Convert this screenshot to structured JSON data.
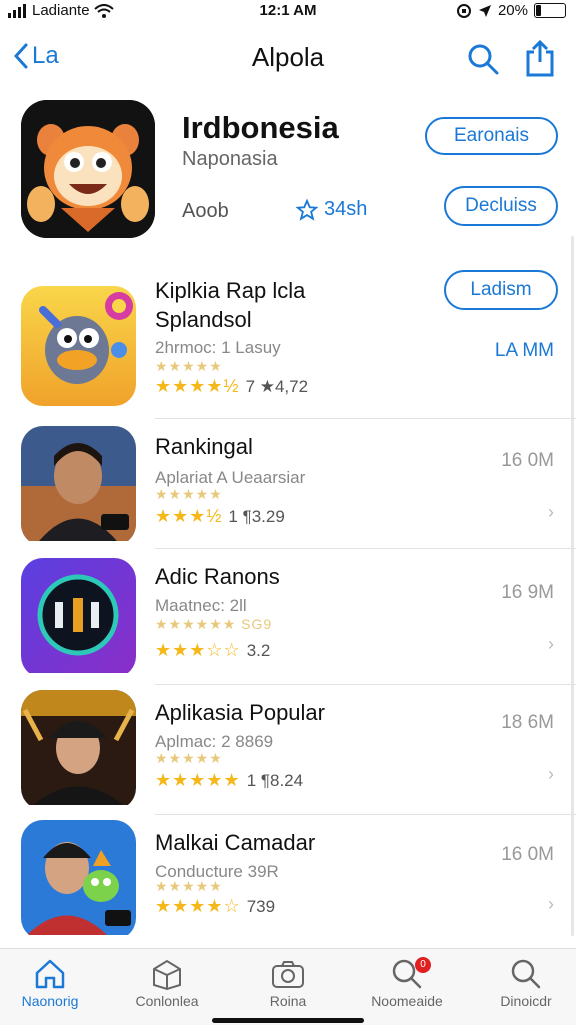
{
  "status": {
    "carrier": "Ladiante",
    "time": "12:1 AM",
    "battery": "20%",
    "battery_level": 0.2
  },
  "nav": {
    "back_label": "La",
    "title": "Alpola"
  },
  "featured": {
    "title": "Irdbonesia",
    "subtitle": "Naponasia",
    "developer": "Aoob",
    "rating": "34sh",
    "button_primary": "Earonais",
    "button_secondary": "Decluiss"
  },
  "apps": [
    {
      "name_line1": "Kiplkia Rap lcla",
      "name_line2": "Splandsol",
      "subtitle": "2hrmoc: 1 Lasuy",
      "faint_stars": "★★★★★",
      "stars": "★★★★½",
      "rating": "7 ★4,72",
      "action": "Ladism",
      "size": "LA MM",
      "chevron": ""
    },
    {
      "name_line1": "Rankingal",
      "name_line2": "",
      "subtitle": "Aplariat A Ueaarsiar",
      "faint_stars": "★★★★★",
      "stars": "★★★½",
      "rating": "1 ¶3.29",
      "action": "",
      "size": "16 0M",
      "chevron": "›"
    },
    {
      "name_line1": "Adic Ranons",
      "name_line2": "",
      "subtitle": "Maatnec: 2ll",
      "faint_stars": "★★★★★★ SG9",
      "stars": "★★★☆☆",
      "rating": "3.2",
      "action": "",
      "size": "16 9M",
      "chevron": "›"
    },
    {
      "name_line1": "Aplikasia Popular",
      "name_line2": "",
      "subtitle": "Aplmac: 2 8869",
      "faint_stars": "★★★★★",
      "stars": "★★★★★",
      "rating": "1 ¶8.24",
      "action": "",
      "size": "18 6M",
      "chevron": "›"
    },
    {
      "name_line1": "Malkai Camadar",
      "name_line2": "",
      "subtitle": "Conducture 39R",
      "faint_stars": "★★★★★",
      "stars": "★★★★☆",
      "rating": "739",
      "action": "",
      "size": "16 0M",
      "chevron": "›"
    }
  ],
  "tabs": [
    {
      "label": "Naonorig",
      "icon": "home-icon",
      "active": true
    },
    {
      "label": "Conlonlea",
      "icon": "box-icon",
      "active": false
    },
    {
      "label": "Roina",
      "icon": "camera-icon",
      "active": false
    },
    {
      "label": "Noomeaide",
      "icon": "search-icon",
      "active": false,
      "badge": "0"
    },
    {
      "label": "Dinoicdr",
      "icon": "search-icon",
      "active": false
    }
  ],
  "colors": {
    "accent": "#1a78d6",
    "star": "#f5b81a",
    "badge": "#e02020"
  }
}
